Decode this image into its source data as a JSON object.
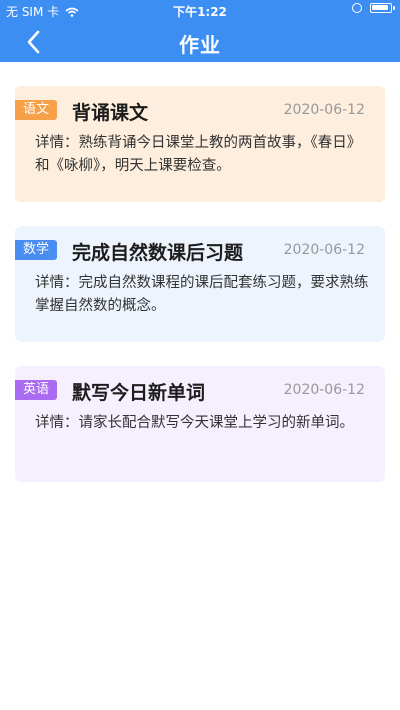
{
  "status_bar": {
    "carrier": "无 SIM 卡",
    "time": "下午1:22"
  },
  "header": {
    "back_icon": "chevron-left-icon",
    "title": "作业"
  },
  "colors": {
    "header_bg": "#3d8ef3",
    "chinese_tag": "#f6a04a",
    "chinese_card": "#fdeedd",
    "math_tag": "#4a8df1",
    "math_card": "#eef4fe",
    "english_tag": "#a96cf0",
    "english_card": "#f6effe"
  },
  "homework": [
    {
      "subject": "语文",
      "title": "背诵课文",
      "date": "2020-06-12",
      "detail": "详情：熟练背诵今日课堂上教的两首故事，《春日》和《咏柳》，明天上课要检查。",
      "tag_color": "#f6a04a",
      "card_color": "#fdeedd"
    },
    {
      "subject": "数学",
      "title": "完成自然数课后习题",
      "date": "2020-06-12",
      "detail": "详情：完成自然数课程的课后配套练习题，要求熟练掌握自然数的概念。",
      "tag_color": "#4a8df1",
      "card_color": "#eef4fe"
    },
    {
      "subject": "英语",
      "title": "默写今日新单词",
      "date": "2020-06-12",
      "detail": "详情：请家长配合默写今天课堂上学习的新单词。",
      "tag_color": "#a96cf0",
      "card_color": "#f6effe"
    }
  ]
}
